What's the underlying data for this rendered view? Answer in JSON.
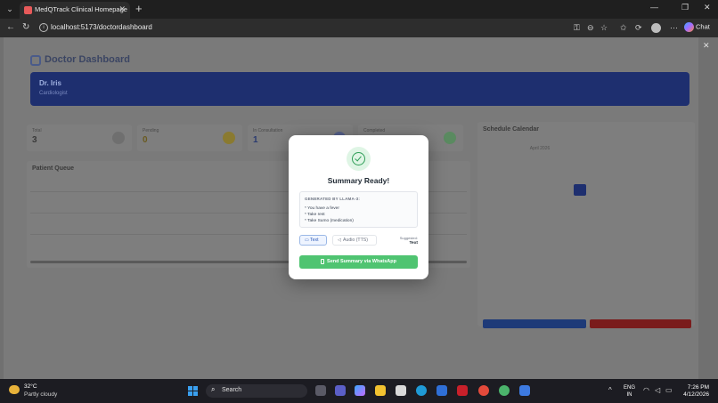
{
  "browser": {
    "tab_title": "MedQTrack Clinical Homepage",
    "url": "localhost:5173/doctordashboard",
    "chat_label": "Chat"
  },
  "dashboard": {
    "title": "Doctor Dashboard",
    "banner_name": "Dr. Iris",
    "banner_sub": "Cardiologist",
    "stats": [
      {
        "label": "Total",
        "value": "3"
      },
      {
        "label": "Pending",
        "value": "0"
      },
      {
        "label": "In Consultation",
        "value": "1"
      },
      {
        "label": "Completed",
        "value": ""
      }
    ],
    "queue_title": "Patient Queue",
    "calendar_title": "Schedule Calendar",
    "calendar_month": "April 2026"
  },
  "modal": {
    "title": "Summary Ready!",
    "generated_by": "GENERATED BY LLAMA-3:",
    "lines": [
      "* You have a fever",
      "* Take rest",
      "* Take Sumo (medication)"
    ],
    "text_button": "Text",
    "audio_button": "Audio (TTS)",
    "suggested_label": "Suggested:",
    "suggested_value": "Text",
    "whatsapp_button": "Send Summary via WhatsApp"
  },
  "taskbar": {
    "temperature": "32°C",
    "weather": "Partly cloudy",
    "search_label": "Search",
    "lang_top": "ENG",
    "lang_bottom": "IN",
    "time": "7:26 PM",
    "date": "4/12/2026"
  },
  "colors": {
    "accent_green": "#4fc471",
    "banner_blue": "#1e2f6f",
    "text_button_blue": "#2f5bb7"
  }
}
